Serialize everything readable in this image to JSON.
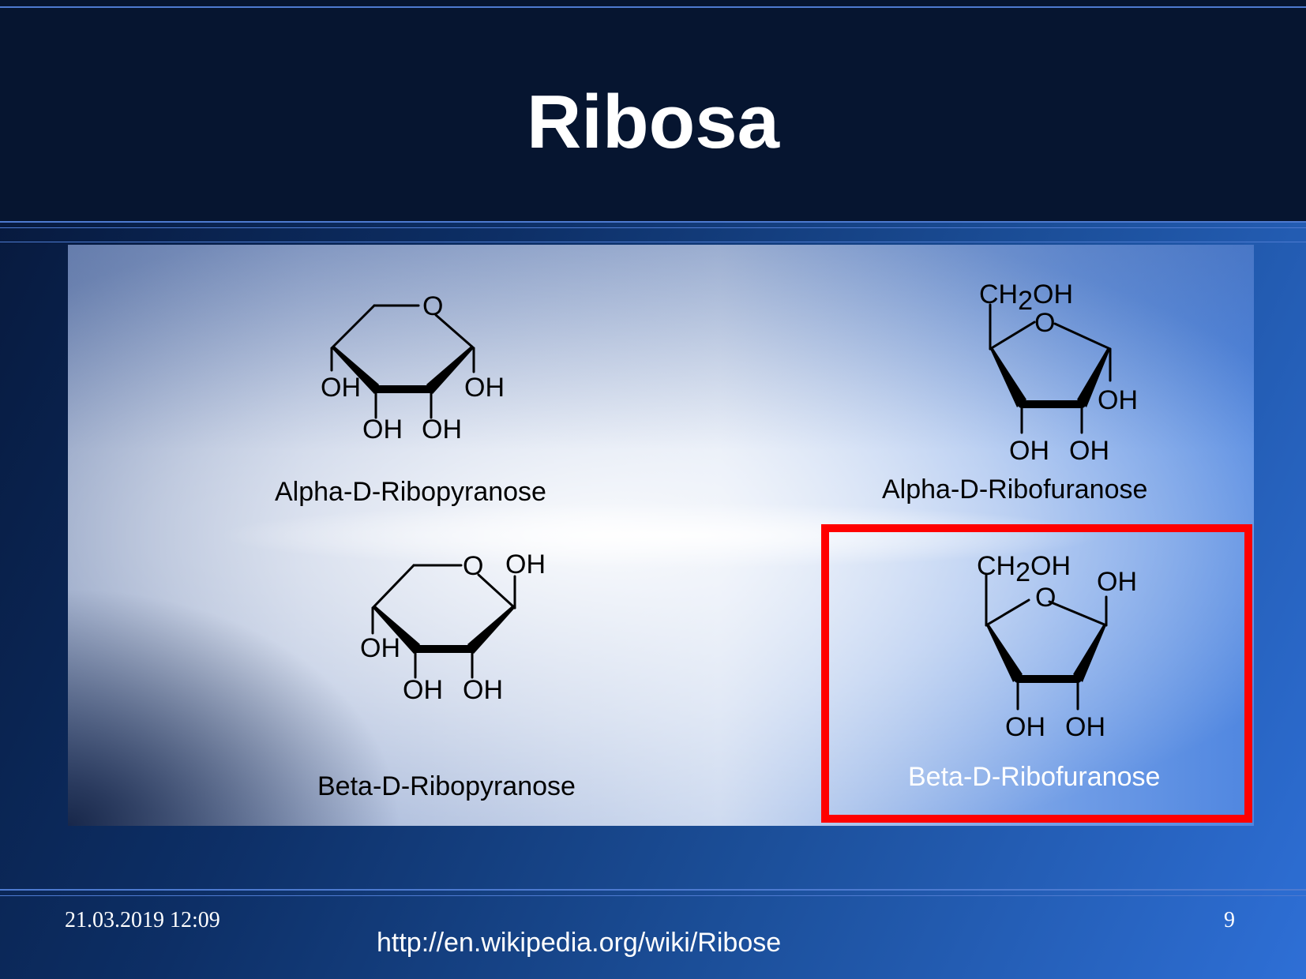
{
  "slide": {
    "title": "Ribosa",
    "date": "21.03.2019 12:09",
    "page_number": "9",
    "source_url": "http://en.wikipedia.org/wiki/Ribose"
  },
  "atoms": {
    "oxygen": "O",
    "hydroxyl": "OH",
    "ch2_c": "CH",
    "ch2_sub": "2",
    "ch2_oh": "OH"
  },
  "molecules": {
    "alpha_pyranose": {
      "name": "Alpha-D-Ribopyranose"
    },
    "alpha_furanose": {
      "name": "Alpha-D-Ribofuranose"
    },
    "beta_pyranose": {
      "name": "Beta-D-Ribopyranose"
    },
    "beta_furanose": {
      "name": "Beta-D-Ribofuranose",
      "highlighted": true
    }
  },
  "colors": {
    "highlight_border": "#ff0000",
    "header_background": "#061530",
    "text_light": "#ffffff",
    "text_dark": "#000000"
  }
}
